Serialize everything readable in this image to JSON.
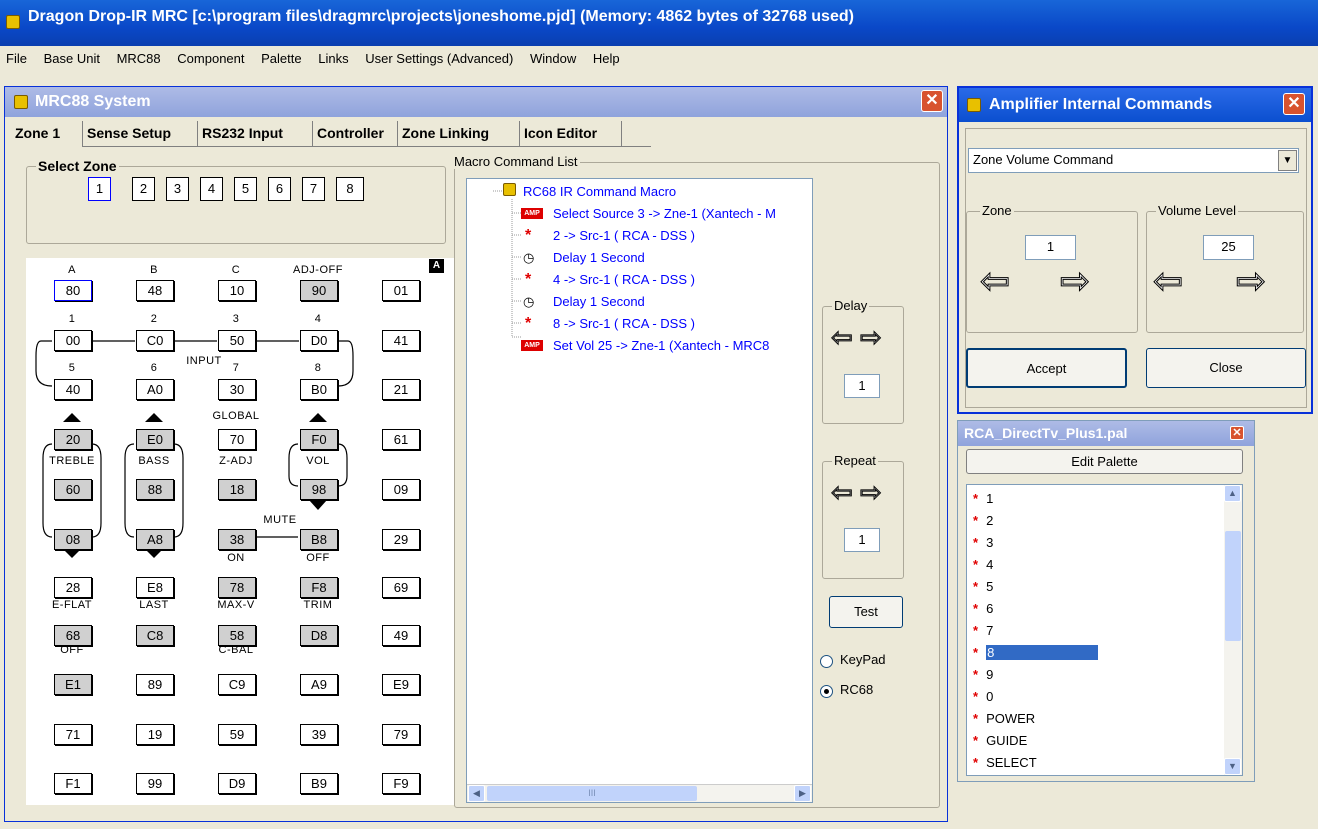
{
  "app": {
    "title": "Dragon Drop-IR MRC [c:\\program files\\dragmrc\\projects\\joneshome.pjd] (Memory: 4862 bytes of 32768 used)"
  },
  "menu": [
    "File",
    "Base Unit",
    "MRC88",
    "Component",
    "Palette",
    "Links",
    "User Settings (Advanced)",
    "Window",
    "Help"
  ],
  "mrc": {
    "title": "MRC88 System",
    "tabs": [
      "Zone 1",
      "Sense Setup",
      "RS232 Input",
      "Controller",
      "Zone Linking",
      "Icon Editor"
    ],
    "select_zone": "Select Zone",
    "zones": [
      "1",
      "2",
      "3",
      "4",
      "5",
      "6",
      "7",
      "8"
    ],
    "keypad_badge": "A",
    "keys": [
      [
        "80",
        "48",
        "10",
        "90",
        "01"
      ],
      [
        "00",
        "C0",
        "50",
        "D0",
        "41"
      ],
      [
        "40",
        "A0",
        "30",
        "B0",
        "21"
      ],
      [
        "20",
        "E0",
        "70",
        "F0",
        "61"
      ],
      [
        "60",
        "88",
        "18",
        "98",
        "09"
      ],
      [
        "08",
        "A8",
        "38",
        "B8",
        "29"
      ],
      [
        "28",
        "E8",
        "78",
        "F8",
        "69"
      ],
      [
        "68",
        "C8",
        "58",
        "D8",
        "49"
      ],
      [
        "E1",
        "89",
        "C9",
        "A9",
        "E9"
      ],
      [
        "71",
        "19",
        "59",
        "39",
        "79"
      ],
      [
        "F1",
        "99",
        "D9",
        "B9",
        "F9"
      ]
    ],
    "key_labels": {
      "row0": [
        "A",
        "B",
        "C",
        "ADJ-OFF"
      ],
      "row1": [
        "1",
        "2",
        "3",
        "4"
      ],
      "input": "INPUT",
      "row2": [
        "5",
        "6",
        "7",
        "8"
      ],
      "global": "GLOBAL",
      "row3": [
        "TREBLE",
        "BASS",
        "Z-ADJ",
        "VOL"
      ],
      "mute": "MUTE",
      "row5": [
        "ON",
        "OFF"
      ],
      "row6": [
        "E-FLAT",
        "LAST",
        "MAX-V",
        "TRIM"
      ],
      "row7": [
        "OFF",
        "C-BAL"
      ]
    },
    "macro_list_label": "Macro Command List",
    "macro": {
      "root": "RC68 IR Command Macro",
      "items": [
        {
          "icon": "AMP",
          "text": "Select Source 3 -> Zne-1 (Xantech - M"
        },
        {
          "icon": "star",
          "text": "2 -> Src-1 ( RCA - DSS )"
        },
        {
          "icon": "clock",
          "text": "Delay 1 Second"
        },
        {
          "icon": "star",
          "text": "4 -> Src-1 ( RCA - DSS )"
        },
        {
          "icon": "clock",
          "text": "Delay 1 Second"
        },
        {
          "icon": "star",
          "text": "8 -> Src-1 ( RCA - DSS )"
        },
        {
          "icon": "AMP",
          "text": "Set Vol 25 -> Zne-1 (Xantech - MRC8"
        }
      ]
    },
    "delay_label": "Delay",
    "delay_value": "1",
    "repeat_label": "Repeat",
    "repeat_value": "1",
    "test_label": "Test",
    "radio_keypad": "KeyPad",
    "radio_rc68": "RC68",
    "scroll_thumb": "III"
  },
  "amp": {
    "title": "Amplifier Internal Commands",
    "command": "Zone Volume Command",
    "zone_label": "Zone",
    "zone_value": "1",
    "volume_label": "Volume Level",
    "volume_value": "25",
    "accept_label": "Accept",
    "close_label": "Close"
  },
  "palette": {
    "title": "RCA_DirectTv_Plus1.pal",
    "edit_label": "Edit Palette",
    "items": [
      "1",
      "2",
      "3",
      "4",
      "5",
      "6",
      "7",
      "8",
      "9",
      "0",
      "POWER",
      "GUIDE",
      "SELECT"
    ],
    "selected_index": 7
  },
  "colors": {
    "title_blue": "#0A48C8",
    "link_blue": "#0000FF",
    "star_red": "#E00000",
    "selection": "#316AC5"
  }
}
